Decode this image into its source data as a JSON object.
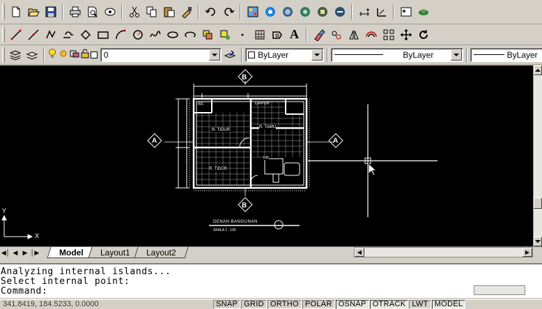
{
  "toolbar_standard": {
    "icons": [
      "new-file-icon",
      "open-icon",
      "save-icon",
      "print-icon",
      "plot-preview-icon",
      "publish-icon",
      "cut-icon",
      "copy-icon",
      "paste-icon",
      "match-properties-icon",
      "undo-icon",
      "redo-icon",
      "design-center-icon",
      "autocad-a-icon",
      "tool-palette-icon",
      "sheet-set-icon",
      "markup-icon",
      "calculator-icon",
      "measure-icon",
      "dimension-icon",
      "properties-icon",
      "sun-icon"
    ]
  },
  "toolbar_draw": {
    "icons": [
      "line-icon",
      "construction-line-icon",
      "polyline-icon",
      "polygon-icon",
      "rectangle-icon",
      "arc-icon",
      "circle-icon",
      "revision-cloud-icon",
      "spline-icon",
      "ellipse-icon",
      "ellipse-arc-icon",
      "insert-block-icon",
      "make-block-icon",
      "point-icon",
      "hatch-icon",
      "region-icon",
      "text-icon",
      "erase-icon",
      "copy-object-icon",
      "mirror-icon",
      "offset-icon",
      "array-icon",
      "move-icon",
      "rotate-icon"
    ],
    "text_icon_glyph": "A"
  },
  "layers": {
    "layer_value": "0",
    "color_value": "ByLayer",
    "linetype_value": "ByLayer",
    "lineweight_value": "ByLayer"
  },
  "drawing": {
    "axis_label_top": "B",
    "axis_label_bottom": "B",
    "axis_label_left": "A",
    "axis_label_right": "A",
    "room_1": "WC",
    "room_2": "DAPUR",
    "room_3": "R. TIDUR",
    "room_4": "R. TAMU",
    "room_5": "R. TIDUR",
    "room_6": "KM",
    "title_text": "DENAH BANGUNAN",
    "scale_text": "SKALA 1 : 100",
    "ucs_x": "X",
    "ucs_y": "Y"
  },
  "tabs": {
    "model": "Model",
    "layout1": "Layout1",
    "layout2": "Layout2"
  },
  "command": {
    "line1": "Analyzing internal islands...",
    "line2": "Select internal point:",
    "line3": "Command:"
  },
  "status": {
    "coordinates": "341.8419, 184.5233, 0.0000",
    "buttons": [
      "SNAP",
      "GRID",
      "ORTHO",
      "POLAR",
      "OSNAP",
      "OTRACK",
      "LWT",
      "MODEL"
    ]
  }
}
